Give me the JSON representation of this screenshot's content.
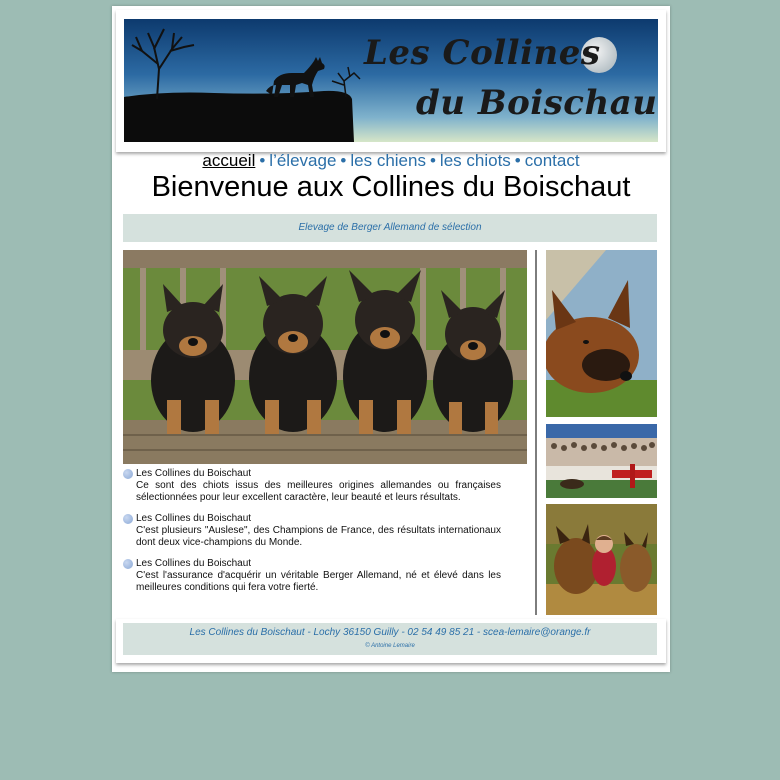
{
  "banner": {
    "title_line1": "Les Collines",
    "title_line2": "du Boischaut"
  },
  "nav": {
    "items": [
      {
        "label": "accueil",
        "current": true
      },
      {
        "label": "l’élevage",
        "current": false
      },
      {
        "label": "les chiens",
        "current": false
      },
      {
        "label": "les chiots",
        "current": false
      },
      {
        "label": "contact",
        "current": false
      }
    ],
    "separator": "•"
  },
  "page_title": "Bienvenue aux Collines du Boischaut",
  "subtitle": "Elevage de Berger Allemand de sélection",
  "items": [
    {
      "title": "Les Collines du Boischaut",
      "text": "Ce sont des chiots issus des meilleures origines allemandes ou françaises sélectionnées pour leur excellent caractère, leur beauté et leurs résultats."
    },
    {
      "title": "Les Collines du Boischaut",
      "text": "C'est plusieurs \"Auslese\", des Champions de France, des résultats internationaux dont deux vice-champions du Monde."
    },
    {
      "title": "Les Collines du Boischaut",
      "text": "C'est l'assurance d'acquérir un véritable Berger Allemand, né et élevé dans les meilleures conditions qui fera votre fierté."
    }
  ],
  "footer": {
    "contact": "Les Collines du Boischaut - Lochy 36150 Guilly - 02 54 49 85 21 - scea-lemaire@orange.fr",
    "credit": "© Antoine Lemaire"
  },
  "colors": {
    "background": "#9dbcb4",
    "accent_blue": "#2b6fa8",
    "panel": "#d5e1dd"
  }
}
